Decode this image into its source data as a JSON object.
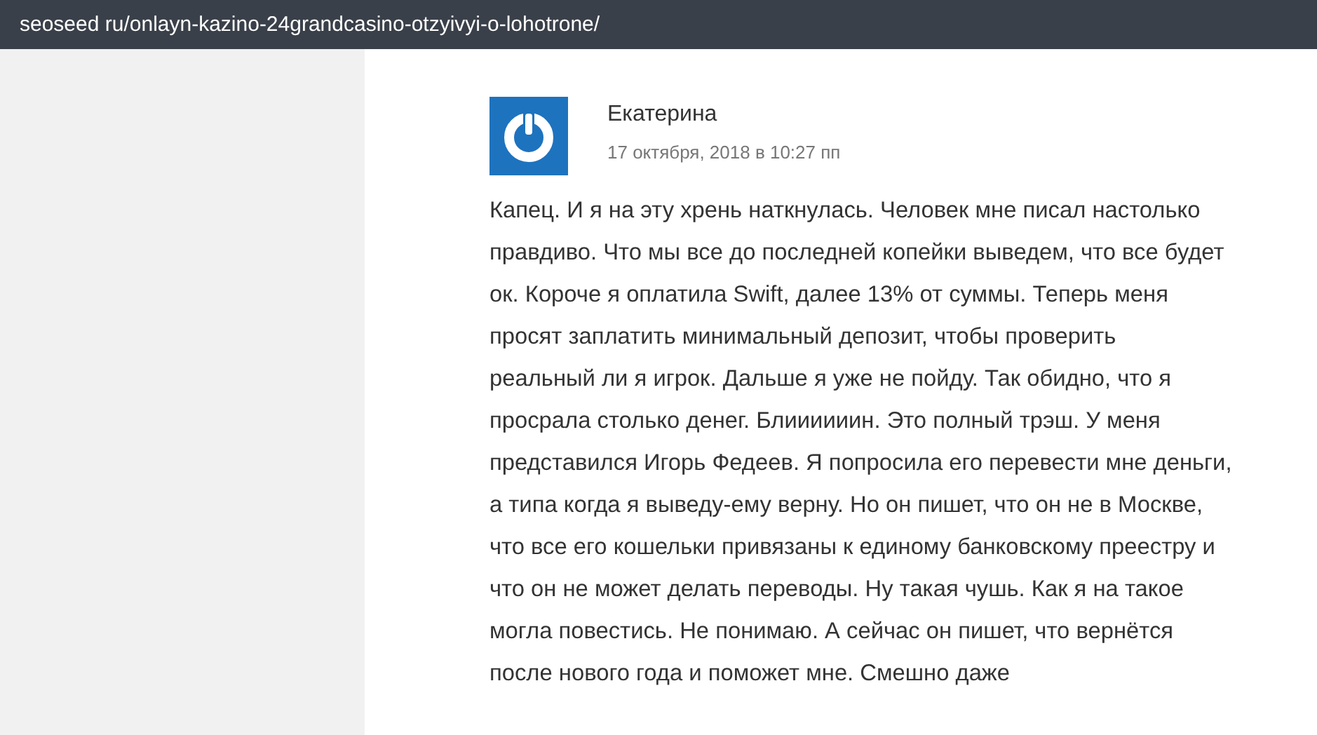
{
  "address_bar": {
    "url": "seoseed ru/onlayn-kazino-24grandcasino-otzyivyi-o-lohotrone/"
  },
  "comment": {
    "author": "Екатерина",
    "date": "17 октября, 2018 в 10:27 пп",
    "lines": [
      "Капец. И я на эту хрень наткнулась. Человек мне писал настолько",
      "правдиво. Что мы все до последней копейки выведем, что все будет",
      "ок. Короче я оплатила Swift, далее 13% от суммы. Теперь меня",
      "просят заплатить минимальный депозит, чтобы проверить",
      "реальный ли я игрок. Дальше я уже не пойду. Так обидно, что я",
      "просрала столько денег. Блиииииин. Это полный трэш. У меня",
      "представился Игорь Федеев. Я попросила его перевести мне деньги,",
      "а типа когда я выведу-ему верну. Но он пишет, что он не в Москве,",
      "что все его кошельки привязаны к единому банковскому преестру и",
      "что он не может делать переводы. Ну такая чушь. Как я на такое",
      "могла повестись. Не понимаю. А сейчас он пишет, что вернётся",
      "после нового года и поможет мне. Смешно даже"
    ]
  }
}
